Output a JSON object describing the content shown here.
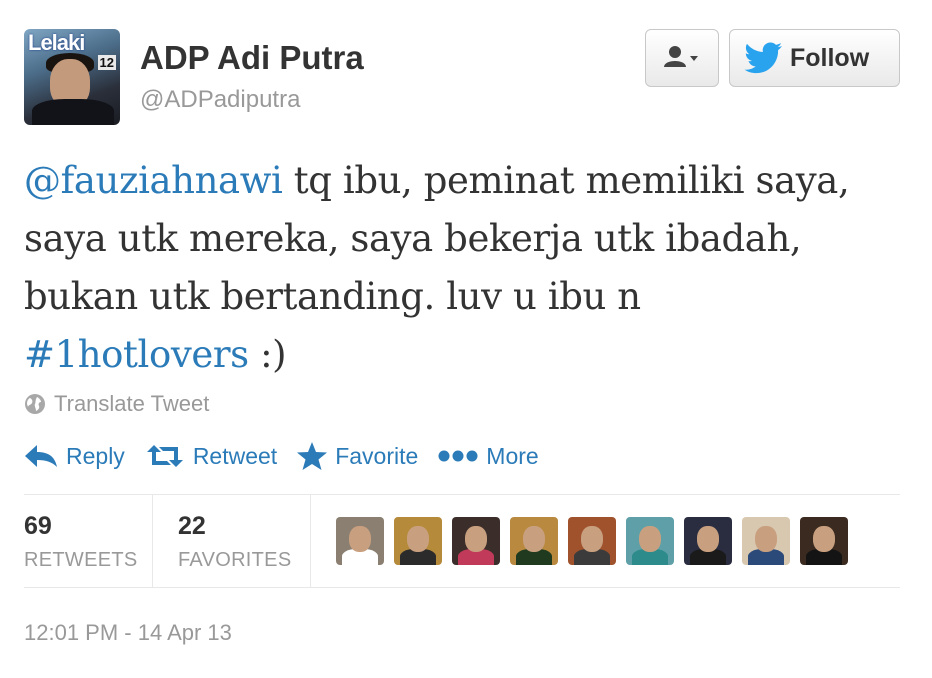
{
  "user": {
    "display_name": "ADP Adi Putra",
    "handle": "@ADPadiputra",
    "avatar": {
      "magazine_title": "Lelaki",
      "issue_number": "12"
    }
  },
  "buttons": {
    "user_menu_icon": "user-dropdown-icon",
    "follow_label": "Follow",
    "follow_icon": "twitter-bird-icon"
  },
  "tweet": {
    "line1": {
      "mention": "@fauziahnawi",
      "text": " tq ibu, peminat memiliki saya,"
    },
    "line2": "saya utk mereka, saya bekerja utk ibadah,",
    "line3": "bukan utk bertanding. luv u ibu n",
    "line4": {
      "hashtag": "#1hotlovers",
      "text": " :)"
    }
  },
  "translate": {
    "label": "Translate Tweet",
    "icon": "globe-icon"
  },
  "actions": [
    {
      "label": "Reply",
      "icon": "reply-icon"
    },
    {
      "label": "Retweet",
      "icon": "retweet-icon"
    },
    {
      "label": "Favorite",
      "icon": "star-icon"
    },
    {
      "label": "More",
      "icon": "more-dots-icon"
    }
  ],
  "stats": {
    "retweets": {
      "count": "69",
      "label": "RETWEETS"
    },
    "favorites": {
      "count": "22",
      "label": "FAVORITES"
    }
  },
  "favoriters": [
    {
      "bg": "#8a7f70",
      "body": "#ffffff"
    },
    {
      "bg": "#b58a3a",
      "body": "#2b2b2b"
    },
    {
      "bg": "#3a2d2a",
      "body": "#c23a5a"
    },
    {
      "bg": "#b8893f",
      "body": "#1f3a1f"
    },
    {
      "bg": "#a0522d",
      "body": "#3b3b3b"
    },
    {
      "bg": "#5fa0a8",
      "body": "#2e8b8b"
    },
    {
      "bg": "#2a2d40",
      "body": "#1a1a1a"
    },
    {
      "bg": "#d8c8b0",
      "body": "#2b4a7a"
    },
    {
      "bg": "#3a2a20",
      "body": "#141414"
    }
  ],
  "timestamp": "12:01 PM - 14 Apr 13",
  "colors": {
    "link": "#2b7bb9",
    "text": "#333333",
    "muted": "#999999"
  }
}
